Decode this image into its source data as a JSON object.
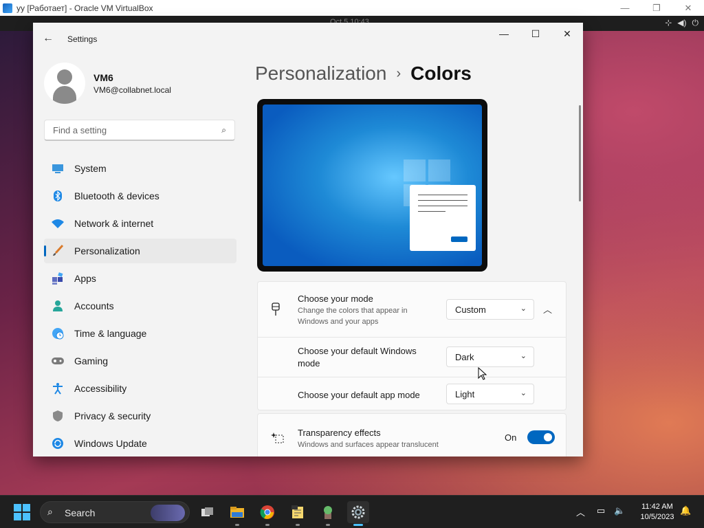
{
  "host": {
    "title": "yy [Работает] - Oracle VM VirtualBox",
    "controls": {
      "minimize": "—",
      "restore": "❐",
      "close": "✕"
    }
  },
  "guest_top": {
    "clock": "Oct 5  10:43",
    "tray": [
      "⊹",
      "◀)",
      "⏻"
    ]
  },
  "window": {
    "app_title": "Settings",
    "back_icon": "←",
    "controls": {
      "minimize": "—",
      "maximize": "☐",
      "close": "✕"
    }
  },
  "user": {
    "name": "VM6",
    "email": "VM6@collabnet.local"
  },
  "search": {
    "placeholder": "Find a setting",
    "value": ""
  },
  "nav": {
    "items": [
      {
        "label": "System",
        "icon": "system-icon"
      },
      {
        "label": "Bluetooth & devices",
        "icon": "bluetooth-icon"
      },
      {
        "label": "Network & internet",
        "icon": "wifi-icon"
      },
      {
        "label": "Personalization",
        "icon": "brush-icon",
        "active": true
      },
      {
        "label": "Apps",
        "icon": "apps-icon"
      },
      {
        "label": "Accounts",
        "icon": "person-icon"
      },
      {
        "label": "Time & language",
        "icon": "globe-clock-icon"
      },
      {
        "label": "Gaming",
        "icon": "gamepad-icon"
      },
      {
        "label": "Accessibility",
        "icon": "accessibility-icon"
      },
      {
        "label": "Privacy & security",
        "icon": "shield-icon"
      },
      {
        "label": "Windows Update",
        "icon": "update-icon"
      }
    ]
  },
  "breadcrumb": {
    "parent": "Personalization",
    "separator": "›",
    "current": "Colors"
  },
  "mode": {
    "title": "Choose your mode",
    "subtitle_line1": "Change the colors that appear in",
    "subtitle_line2": "Windows and your apps",
    "value": "Custom",
    "windows_mode_line1": "Choose your default Windows",
    "windows_mode_line2": "mode",
    "windows_mode_value": "Dark",
    "app_mode_title": "Choose your default app mode",
    "app_mode_value": "Light"
  },
  "transparency": {
    "title": "Transparency effects",
    "subtitle": "Windows and surfaces appear translucent",
    "state_label": "On",
    "enabled": true
  },
  "taskbar": {
    "search_label": "Search",
    "clock_time": "11:42 AM",
    "clock_date": "10/5/2023",
    "accent": "#4cc2ff"
  },
  "colors": {
    "accent": "#0067c0",
    "window_bg": "#f3f3f3"
  }
}
